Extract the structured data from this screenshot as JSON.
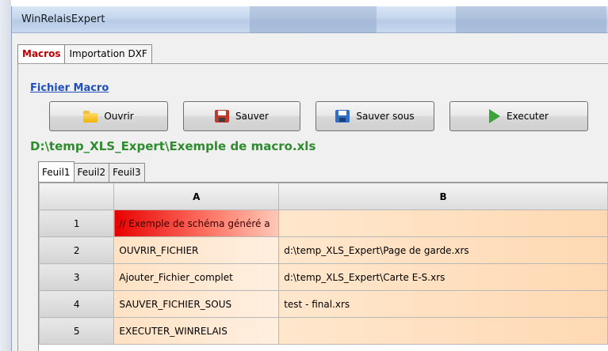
{
  "window": {
    "title": "WinRelaisExpert"
  },
  "tabs": [
    {
      "label": "Macros",
      "active": true
    },
    {
      "label": "Importation DXF",
      "active": false
    }
  ],
  "macro": {
    "section_label": "Fichier Macro",
    "buttons": [
      {
        "label": "Ouvrir",
        "icon": "folder-icon"
      },
      {
        "label": "Sauver",
        "icon": "save-icon"
      },
      {
        "label": "Sauver sous",
        "icon": "save-as-icon"
      },
      {
        "label": "Executer",
        "icon": "play-icon"
      }
    ],
    "file_path": "D:\\temp_XLS_Expert\\Exemple de macro.xls"
  },
  "sheets": [
    {
      "label": "Feuil1",
      "active": true
    },
    {
      "label": "Feuil2",
      "active": false
    },
    {
      "label": "Feuil3",
      "active": false
    }
  ],
  "grid": {
    "columns": [
      "A",
      "B"
    ],
    "rows": [
      {
        "num": "1",
        "a": "// Exemple de schéma généré a",
        "b": ""
      },
      {
        "num": "2",
        "a": "OUVRIR_FICHIER",
        "b": "d:\\temp_XLS_Expert\\Page de garde.xrs"
      },
      {
        "num": "3",
        "a": "Ajouter_Fichier_complet",
        "b": "d:\\temp_XLS_Expert\\Carte E-S.xrs"
      },
      {
        "num": "4",
        "a": "SAUVER_FICHIER_SOUS",
        "b": "test - final.xrs"
      },
      {
        "num": "5",
        "a": "EXECUTER_WINRELAIS",
        "b": ""
      }
    ]
  },
  "colors": {
    "path_text": "#2e8b2e",
    "active_tab_text": "#c00000",
    "link": "#1f4fb8",
    "cell_red": "#e80000",
    "cell_orange": "#ffe2c4"
  }
}
